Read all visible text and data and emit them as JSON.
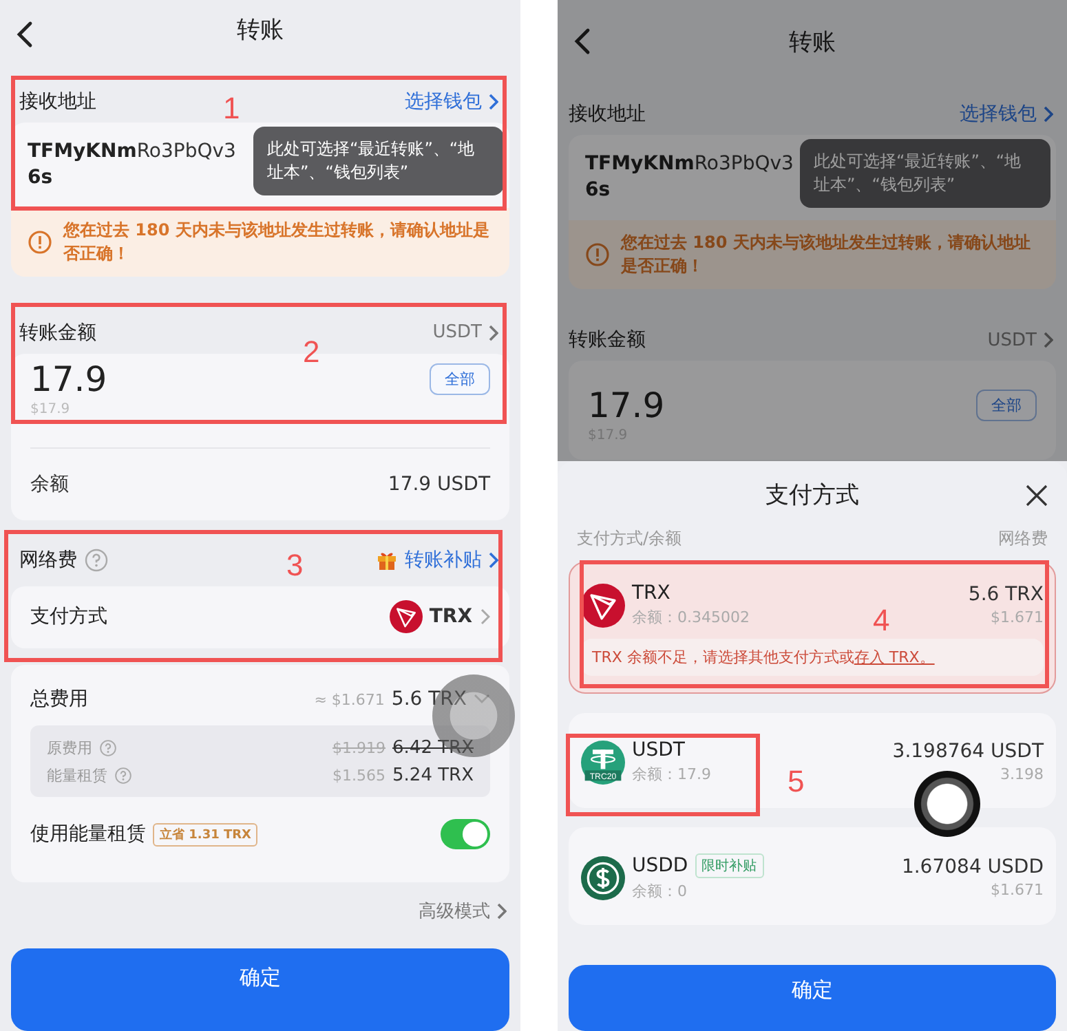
{
  "screens": [
    {
      "dimmed": false,
      "title": "转账",
      "address": {
        "label": "接收地址",
        "link": "选择钱包",
        "bold": "TFMyKNm",
        "rest": "Ro3PbQv3",
        "line2": "6s"
      },
      "tooltip": "此处可选择“最近转账”、“地址本”、“钱包列表”",
      "warning": "您在过去 180 天内未与该地址发生过转账，请确认地址是否正确！",
      "amount": {
        "label": "转账金额",
        "asset": "USDT",
        "value": "17.9",
        "fiat": "$17.9",
        "max_button": "全部",
        "balance_label": "余额",
        "balance": "17.9 USDT"
      },
      "fee": {
        "label": "网络费",
        "subsidy": "转账补贴",
        "method_label": "支付方式",
        "method": "TRX"
      },
      "total": {
        "label": "总费用",
        "fiat": "≈ $1.671",
        "value": "5.6 TRX",
        "rows": [
          {
            "label": "原费用",
            "fiat": "$1.919",
            "value": "6.42 TRX",
            "struck": true
          },
          {
            "label": "能量租赁",
            "fiat": "$1.565",
            "value": "5.24 TRX",
            "struck": false
          }
        ],
        "rental": {
          "label": "使用能量租赁",
          "badge": "立省 1.31 TRX",
          "on": true
        }
      },
      "advanced": "高级模式",
      "confirm": "确定"
    },
    {
      "dimmed": true,
      "title": "转账",
      "address": {
        "label": "接收地址",
        "link": "选择钱包",
        "bold": "TFMyKNm",
        "rest": "Ro3PbQv3",
        "line2": "6s"
      },
      "tooltip": "此处可选择“最近转账”、“地址本”、“钱包列表”",
      "warning": "您在过去 180 天内未与该地址发生过转账，请确认地址是否正确！",
      "amount": {
        "label": "转账金额",
        "asset": "USDT",
        "value": "17.9",
        "fiat": "$17.9",
        "max_button": "全部"
      },
      "sheet": {
        "title": "支付方式",
        "col_left": "支付方式/余额",
        "col_right": "网络费",
        "options": [
          {
            "kind": "trx",
            "name": "TRX",
            "balance": "余额：0.345002",
            "fee": "5.6 TRX",
            "fiat": "$1.671",
            "insufficient": true,
            "warning": "TRX 余额不足，请选择其他支付方式或",
            "link": "存入 TRX。"
          },
          {
            "kind": "usdt",
            "name": "USDT",
            "icon_label": "TRC20",
            "balance": "余额：17.9",
            "fee": "3.198764 USDT",
            "fiat": "3.198",
            "insufficient": false
          },
          {
            "kind": "usdd",
            "name": "USDD",
            "badge": "限时补贴",
            "balance": "余额：0",
            "fee": "1.67084 USDD",
            "fiat": "$1.671",
            "insufficient": false
          }
        ],
        "confirm": "确定"
      }
    }
  ],
  "annotations": [
    {
      "number": "1"
    },
    {
      "number": "2"
    },
    {
      "number": "3"
    },
    {
      "number": "4"
    },
    {
      "number": "5"
    }
  ]
}
